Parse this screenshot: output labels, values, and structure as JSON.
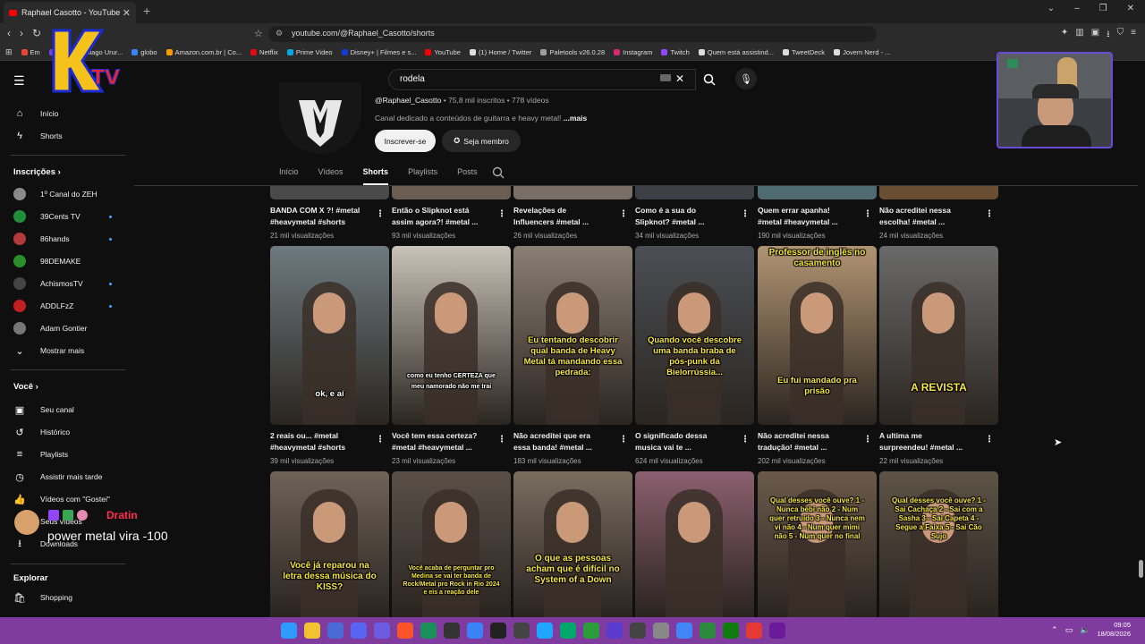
{
  "browser": {
    "tab_title": "Raphael Casotto - YouTube",
    "url": "youtube.com/@Raphael_Casotto/shorts",
    "bookmarks": [
      {
        "label": "Em",
        "color": "#ea4335"
      },
      {
        "label": "Email – Thiago Urur...",
        "color": "#7b3fe4"
      },
      {
        "label": "globo",
        "color": "#3b82f6"
      },
      {
        "label": "Amazon.com.br | Co...",
        "color": "#ff9900"
      },
      {
        "label": "Netflix",
        "color": "#e50914"
      },
      {
        "label": "Prime Video",
        "color": "#00a8e1"
      },
      {
        "label": "Disney+ | Filmes e s...",
        "color": "#113ccf"
      },
      {
        "label": "YouTube",
        "color": "#ff0000"
      },
      {
        "label": "(1) Home / Twitter",
        "color": "#dddddd"
      },
      {
        "label": "Paletools v26.0.28",
        "color": "#9aa0a6"
      },
      {
        "label": "Instagram",
        "color": "#d62976"
      },
      {
        "label": "Twitch",
        "color": "#9146ff"
      },
      {
        "label": "Quem está assistind...",
        "color": "#dddddd"
      },
      {
        "label": "TweetDeck",
        "color": "#dddddd"
      },
      {
        "label": "Jovem Nerd - ...",
        "color": "#dddddd"
      }
    ]
  },
  "search": {
    "value": "rodela"
  },
  "sidebar": {
    "main": [
      {
        "label": "Início",
        "icon": "home-icon"
      },
      {
        "label": "Shorts",
        "icon": "shorts-icon"
      }
    ],
    "subs_header": "Inscrições",
    "subs": [
      {
        "label": "1º Canal do ZEH",
        "color": "#8a8a8a",
        "new": false
      },
      {
        "label": "39Cents TV",
        "color": "#1f8f3a",
        "new": true
      },
      {
        "label": "86hands",
        "color": "#b23a3a",
        "new": true
      },
      {
        "label": "98DEMAKE",
        "color": "#2a8f2a",
        "new": false
      },
      {
        "label": "AchismosTV",
        "color": "#444444",
        "new": true
      },
      {
        "label": "ADDLFzZ",
        "color": "#c22020",
        "new": true
      },
      {
        "label": "Adam Gontier",
        "color": "#777777",
        "new": false
      }
    ],
    "show_more": "Mostrar mais",
    "you_header": "Você",
    "you": [
      {
        "label": "Seu canal",
        "icon": "channel-icon"
      },
      {
        "label": "Histórico",
        "icon": "history-icon"
      },
      {
        "label": "Playlists",
        "icon": "playlists-icon"
      },
      {
        "label": "Assistir mais tarde",
        "icon": "watch-later-icon"
      },
      {
        "label": "Vídeos com \"Gostei\"",
        "icon": "like-icon"
      },
      {
        "label": "Seus vídeos",
        "icon": "your-videos-icon"
      },
      {
        "label": "Downloads",
        "icon": "download-icon"
      }
    ],
    "explore_header": "Explorar",
    "explore": [
      {
        "label": "Shopping",
        "icon": "shopping-icon"
      }
    ]
  },
  "channel": {
    "handle": "@Raphael_Casotto",
    "stats": " • 75,8 mil inscritos • 778 vídeos",
    "description": "Canal dedicado a conteúdos de guitarra e heavy metal!",
    "more": " ...mais",
    "subscribe": "Inscrever-se",
    "join": "Seja membro",
    "tabs": [
      "Início",
      "Vídeos",
      "Shorts",
      "Playlists",
      "Posts"
    ],
    "active_tab": "Shorts"
  },
  "shorts_row1": [
    {
      "title1": "BANDA COM X ?! #metal",
      "title2": "#heavymetal #shorts",
      "views": "21 mil visualizações"
    },
    {
      "title1": "Então o Slipknot está",
      "title2": "assim agora?! #metal ...",
      "views": "93 mil visualizações"
    },
    {
      "title1": "Revelações de",
      "title2": "Influencers #metal ...",
      "views": "26 mil visualizações"
    },
    {
      "title1": "Como é a sua do",
      "title2": "Slipknot? #metal ...",
      "views": "34 mil visualizações"
    },
    {
      "title1": "Quem errar apanha!",
      "title2": "#metal #heavymetal ...",
      "views": "190 mil visualizações"
    },
    {
      "title1": "Não acreditei nessa",
      "title2": "escolha! #metal ...",
      "views": "24 mil visualizações"
    }
  ],
  "shorts_row2": [
    {
      "title1": "2 reais ou... #metal",
      "title2": "#heavymetal #shorts",
      "views": "39 mil visualizações",
      "overlay": "ok, e aí",
      "bg": "#6d7a7f"
    },
    {
      "title1": "Você tem essa certeza?",
      "title2": "#metal #heavymetal ...",
      "views": "23 mil visualizações",
      "overlay": "como eu tenho CERTEZA que meu namorado não me trai",
      "bg": "#c9c2b8"
    },
    {
      "title1": "Não acreditei que era",
      "title2": "essa banda! #metal ...",
      "views": "183 mil visualizações",
      "overlay": "Eu tentando descobrir qual banda de Heavy Metal tá mandando essa pedrada:",
      "bg": "#8a7f73"
    },
    {
      "title1": "O significado dessa",
      "title2": "musica vai te ...",
      "views": "624 mil visualizações",
      "overlay": "Quando você descobre uma banda braba de pós-punk da Bielorrússia...",
      "bg": "#4b4f55"
    },
    {
      "title1": "Não acreditei nessa",
      "title2": "tradução! #metal ...",
      "views": "202 mil visualizações",
      "overlay_top": "Professor de inglês no casamento",
      "overlay": "Eu fui mandado pra prisão",
      "bg": "#b19472"
    },
    {
      "title1": "A ultima me",
      "title2": "surpreendeu! #metal ...",
      "views": "22 mil visualizações",
      "overlay": "A REVISTA",
      "bg": "#6a6a6a"
    }
  ],
  "shorts_row3": [
    {
      "overlay": "Você já reparou na letra dessa música do KISS?",
      "bg": "#6f6357"
    },
    {
      "overlay": "Você acaba de perguntar pro Medina se vai ter banda de Rock/Metal pro Rock in Rio 2024 e eis a reação dele",
      "bg": "#5a5048"
    },
    {
      "overlay": "O que as pessoas acham que é difícil no System of a Down",
      "bg": "#7a6d60"
    },
    {
      "overlay": "",
      "bg": "#8b5f6f"
    },
    {
      "overlay": "Qual desses você ouve? 1 - Nunca bebi não 2 - Num quer retruído 3 - Nunca nem vi não 4 - Num quer mimi não 5 - Num quer no final",
      "bg": "#6b5a4a"
    },
    {
      "overlay": "Qual desses você ouve? 1 - Sai Cachaça 2 - Sai com a Sasha 3 - Sai Capeta 4 - Segue a Faixa 5 - Sai Cão Sujo",
      "bg": "#5d5346"
    }
  ],
  "stream": {
    "logo": "KTV",
    "chat_name": "Dratin",
    "chat_message": "power metal vira -100"
  },
  "taskbar": {
    "time": "09:05",
    "date": "18/08/2026"
  }
}
